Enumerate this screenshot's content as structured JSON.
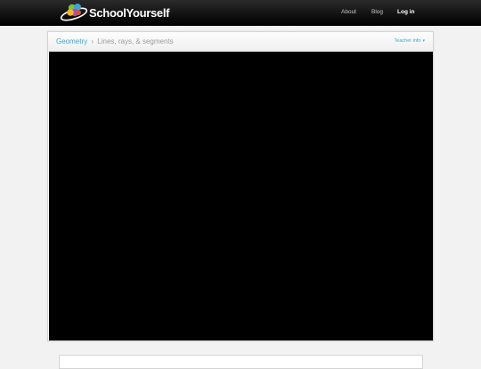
{
  "header": {
    "brand": "SchoolYourself",
    "nav": {
      "about": "About",
      "blog": "Blog",
      "login": "Log in"
    }
  },
  "lesson": {
    "breadcrumb": {
      "subject": "Geometry",
      "separator": "›",
      "topic": "Lines, rays, & segments"
    },
    "teacher_info": "Teacher info",
    "teacher_caret": "▾"
  },
  "colors": {
    "accent": "#3aa5d6",
    "topbar": "#111111",
    "viewport": "#000000"
  }
}
